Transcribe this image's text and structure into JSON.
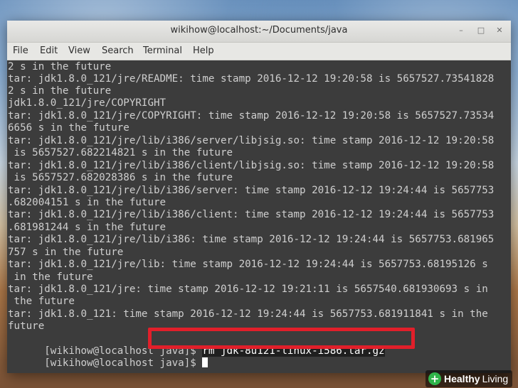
{
  "window": {
    "title": "wikihow@localhost:~/Documents/java",
    "controls": {
      "minimize": "–",
      "maximize": "□",
      "close": "✕"
    }
  },
  "menu": {
    "items": [
      "File",
      "Edit",
      "View",
      "Search",
      "Terminal",
      "Help"
    ]
  },
  "terminal": {
    "lines": [
      "2 s in the future",
      "tar: jdk1.8.0_121/jre/README: time stamp 2016-12-12 19:20:58 is 5657527.73541828",
      "2 s in the future",
      "jdk1.8.0_121/jre/COPYRIGHT",
      "tar: jdk1.8.0_121/jre/COPYRIGHT: time stamp 2016-12-12 19:20:58 is 5657527.73534",
      "6656 s in the future",
      "tar: jdk1.8.0_121/jre/lib/i386/server/libjsig.so: time stamp 2016-12-12 19:20:58",
      " is 5657527.682214821 s in the future",
      "tar: jdk1.8.0_121/jre/lib/i386/client/libjsig.so: time stamp 2016-12-12 19:20:58",
      " is 5657527.682028386 s in the future",
      "tar: jdk1.8.0_121/jre/lib/i386/server: time stamp 2016-12-12 19:24:44 is 5657753",
      ".682004151 s in the future",
      "tar: jdk1.8.0_121/jre/lib/i386/client: time stamp 2016-12-12 19:24:44 is 5657753",
      ".681981244 s in the future",
      "tar: jdk1.8.0_121/jre/lib/i386: time stamp 2016-12-12 19:24:44 is 5657753.681965",
      "757 s in the future",
      "tar: jdk1.8.0_121/jre/lib: time stamp 2016-12-12 19:24:44 is 5657753.68195126 s",
      " in the future",
      "tar: jdk1.8.0_121/jre: time stamp 2016-12-12 19:21:11 is 5657540.681930693 s in",
      " the future",
      "tar: jdk1.8.0_121: time stamp 2016-12-12 19:24:44 is 5657753.681911841 s in the",
      "future"
    ],
    "prompt": "[wikihow@localhost java]$ ",
    "command": "rm jdk-8u121-linux-i586.tar.gz",
    "next_prompt": "[wikihow@localhost java]$ "
  },
  "watermark": {
    "brand": "Healthy",
    "brand2": "Living"
  },
  "colors": {
    "highlight": "#e11f2a",
    "terminal_bg": "#3c3c3c",
    "terminal_fg": "#cfcfcf"
  }
}
